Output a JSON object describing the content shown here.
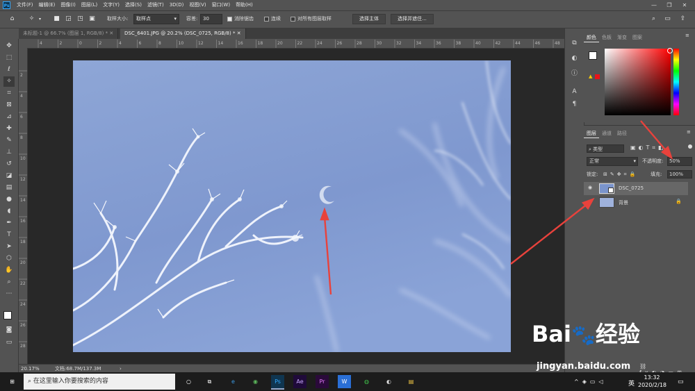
{
  "app": {
    "logo": "Ps"
  },
  "menu": [
    "文件(F)",
    "编辑(E)",
    "图像(I)",
    "图层(L)",
    "文字(Y)",
    "选择(S)",
    "滤镜(T)",
    "3D(D)",
    "视图(V)",
    "窗口(W)",
    "帮助(H)"
  ],
  "options": {
    "sample_size_label": "取样大小:",
    "sample_size_value": "取样点",
    "tolerance_label": "容差:",
    "tolerance_value": "30",
    "antialias_label": "消除锯齿",
    "contiguous_label": "连续",
    "all_layers_label": "对所有图层取样",
    "select_subject": "选择主体",
    "select_mask": "选择并遮住..."
  },
  "tabs": [
    {
      "label": "未标题-1 @ 66.7% (图层 1, RGB/8) *",
      "active": false
    },
    {
      "label": "DSC_6401.JPG @ 20.2% (DSC_0725, RGB/8) *",
      "active": true
    }
  ],
  "ruler_marks": [
    "4",
    "2",
    "0",
    "2",
    "4",
    "6",
    "8",
    "10",
    "12",
    "14",
    "16",
    "18",
    "20",
    "22",
    "24",
    "26",
    "28",
    "30",
    "32",
    "34",
    "36",
    "38",
    "40",
    "42",
    "44",
    "46",
    "48"
  ],
  "vruler_marks": [
    "2",
    "4",
    "6",
    "8",
    "10",
    "12",
    "14",
    "16",
    "18",
    "20",
    "22",
    "24",
    "26",
    "28"
  ],
  "status": {
    "zoom": "20.17%",
    "doc": "文档:68.7M/137.3M"
  },
  "color_panel": {
    "tabs": [
      "颜色",
      "色板",
      "渐变",
      "图案"
    ],
    "foreground": "#ffffff",
    "background": "#e8141a"
  },
  "layers_panel": {
    "tabs": [
      "图层",
      "通道",
      "路径"
    ],
    "filter_label": "类型",
    "blend_mode": "正常",
    "opacity_label": "不透明度:",
    "opacity_value": "50%",
    "lock_label": "锁定:",
    "fill_label": "填充:",
    "fill_value": "100%",
    "layers": [
      {
        "name": "DSC_0725",
        "selected": true
      },
      {
        "name": "背景",
        "selected": false
      }
    ]
  },
  "taskbar": {
    "search_placeholder": "在这里输入你要搜索的内容",
    "ime": "英",
    "time": "13:32",
    "date": "2020/2/18"
  },
  "watermark": {
    "brand": "Bai",
    "brand2": "经验",
    "url": "jingyan.baidu.com"
  },
  "colors": {
    "accent": "#31a8ff",
    "arrow": "#e8423c",
    "photo_sky": "#8aa3d6"
  }
}
